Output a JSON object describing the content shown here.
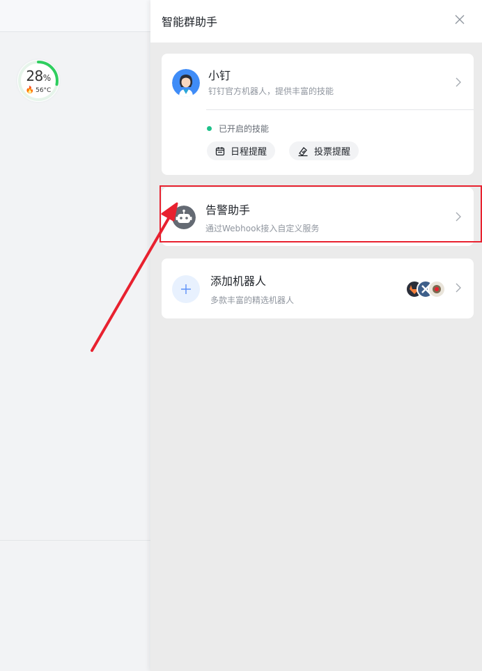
{
  "left": {
    "gauge": {
      "percent": "28",
      "percent_unit": "%",
      "temperature": "56°C",
      "progress": 0.28
    }
  },
  "panel": {
    "title": "智能群助手",
    "close_icon": "close-icon"
  },
  "bots": [
    {
      "name": "小钉",
      "desc": "钉钉官方机器人，提供丰富的技能",
      "skills_label": "已开启的技能",
      "skills": [
        {
          "label": "日程提醒",
          "icon": "calendar-icon"
        },
        {
          "label": "投票提醒",
          "icon": "vote-icon"
        }
      ]
    },
    {
      "name": "告警助手",
      "desc": "通过Webhook接入自定义服务"
    }
  ],
  "add_bot": {
    "title": "添加机器人",
    "desc": "多款丰富的精选机器人"
  },
  "colors": {
    "accent_green": "#1ec18a",
    "highlight_red": "#e8212f",
    "add_blue": "#5b8ff9"
  }
}
